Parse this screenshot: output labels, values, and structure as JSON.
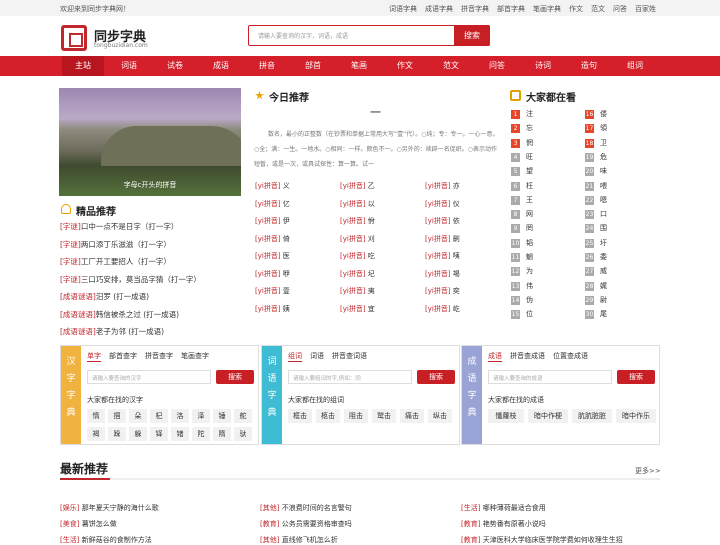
{
  "topbar": {
    "welcome": "欢迎来到同步字典网！",
    "links": [
      "词语字典",
      "成语字典",
      "拼音字典",
      "部首字典",
      "笔画字典",
      "作文",
      "范文",
      "问答",
      "百家姓"
    ]
  },
  "logo": {
    "title": "同步字典",
    "url": "tongbuzidian.com"
  },
  "search": {
    "placeholder": "请输入要查询的汉字，词语，成语",
    "button": "搜索"
  },
  "nav": {
    "items": [
      "主站",
      "词语",
      "试卷",
      "成语",
      "拼音",
      "部首",
      "笔画",
      "作文",
      "范文",
      "问答",
      "诗词",
      "造句",
      "组词"
    ],
    "active": 0
  },
  "hero": {
    "caption": "字母c开头的拼音"
  },
  "recommend": {
    "title": "精品推荐",
    "items": [
      {
        "tag": "[字谜]",
        "text": "口中一点不是日字（打一字）"
      },
      {
        "tag": "[字谜]",
        "text": "两口添丁乐滋滋（打一字）"
      },
      {
        "tag": "[字谜]",
        "text": "工厂开工要招人（打一字）"
      },
      {
        "tag": "[字谜]",
        "text": "三口巧安排，莫当品字猜（打一字）"
      },
      {
        "tag": "[成语谜语]",
        "text": "汨罗 (打一成语)"
      },
      {
        "tag": "[成语谜语]",
        "text": "韩信被杀之过 (打一成语)"
      },
      {
        "tag": "[成语谜语]",
        "text": "老子为邻 (打一成语)"
      }
    ]
  },
  "today": {
    "title": "今日推荐",
    "char": "一",
    "text": "数名，最小的正整数（在钞票和单据上常用大写“壹”代）。○纯；专：专一。一心一意。○全；满：一生。一地水。○相同：一样。颜色不一。○另外的：续辟一名促织。○表示动作短暂，或是一次，或具试探性：算一算。试一"
  },
  "pinyin": {
    "tag": "[yi拼音]",
    "columns": [
      [
        "义",
        "亿",
        "伊",
        "倚",
        "医",
        "咿",
        "壹",
        "姨"
      ],
      [
        "乙",
        "以",
        "佾",
        "刈",
        "吃",
        "圮",
        "夷",
        "宜"
      ],
      [
        "亦",
        "仪",
        "依",
        "劓",
        "咦",
        "埸",
        "奕",
        "屹"
      ]
    ]
  },
  "hot": {
    "title": "大家都在看",
    "left": [
      "注",
      "忘",
      "惘",
      "旺",
      "望",
      "枉",
      "王",
      "网",
      "罔",
      "韬",
      "魍",
      "为",
      "伟",
      "伪",
      "位"
    ],
    "right": [
      "倭",
      "領",
      "卫",
      "危",
      "味",
      "喂",
      "嗯",
      "口",
      "围",
      "圩",
      "委",
      "威",
      "娓",
      "尉",
      "尾"
    ],
    "colors": {
      "top": "#e8462b",
      "rest": "#aaaaaa"
    }
  },
  "panels": [
    {
      "side": [
        "汉",
        "字",
        "字",
        "典"
      ],
      "color": "#f0b340",
      "tabs": [
        "单字",
        "部首查字",
        "拼音查字",
        "笔画查字"
      ],
      "placeholder": "请输入要查询的汉字",
      "button": "搜索",
      "sub": "大家都在找的汉字",
      "chips": [
        "惰",
        "掴",
        "朵",
        "杞",
        "洛",
        "泽",
        "锤",
        "舵",
        "褐",
        "跺",
        "躲",
        "铎",
        "锗",
        "陀",
        "隋",
        "驮"
      ]
    },
    {
      "side": [
        "词",
        "语",
        "字",
        "典"
      ],
      "color": "#3dbcd3",
      "tabs": [
        "组词",
        "词语",
        "拼音查词语"
      ],
      "placeholder": "请输入要组词的字,例如：同",
      "button": "搜索",
      "sub": "大家都在找的组词",
      "chips": [
        "框击",
        "柩击",
        "阻击",
        "鹫击",
        "痛击",
        "纵击"
      ]
    },
    {
      "side": [
        "成",
        "语",
        "字",
        "典"
      ],
      "color": "#9aa3d6",
      "tabs": [
        "成语",
        "拼音查成语",
        "位置查成语"
      ],
      "placeholder": "请输入要查询的成语",
      "button": "搜索",
      "sub": "大家都在找的成语",
      "chips": [
        "懺蘿枝",
        "暗中作梗",
        "肮肮脏脏",
        "暗中作乐"
      ]
    }
  ],
  "latest": {
    "title": "最新推荐",
    "more": "更多>>",
    "items": [
      {
        "tag": "[娱乐]",
        "text": "那年夏天宁静的海什么歌"
      },
      {
        "tag": "[其他]",
        "text": "不浪费时间的名言警句"
      },
      {
        "tag": "[生活]",
        "text": "哪种薄荷最适合食用"
      },
      {
        "tag": "[美食]",
        "text": "薯饼怎么做"
      },
      {
        "tag": "[教育]",
        "text": "公务员需要资格审查吗"
      },
      {
        "tag": "[教育]",
        "text": "艳势番有原著小说吗"
      },
      {
        "tag": "[生活]",
        "text": "新鲜菇谷的食制作方法"
      },
      {
        "tag": "[其他]",
        "text": "直线修飞机怎么折"
      },
      {
        "tag": "[教育]",
        "text": "天津医科大学临床医学院学费如何收理生生招"
      }
    ]
  }
}
